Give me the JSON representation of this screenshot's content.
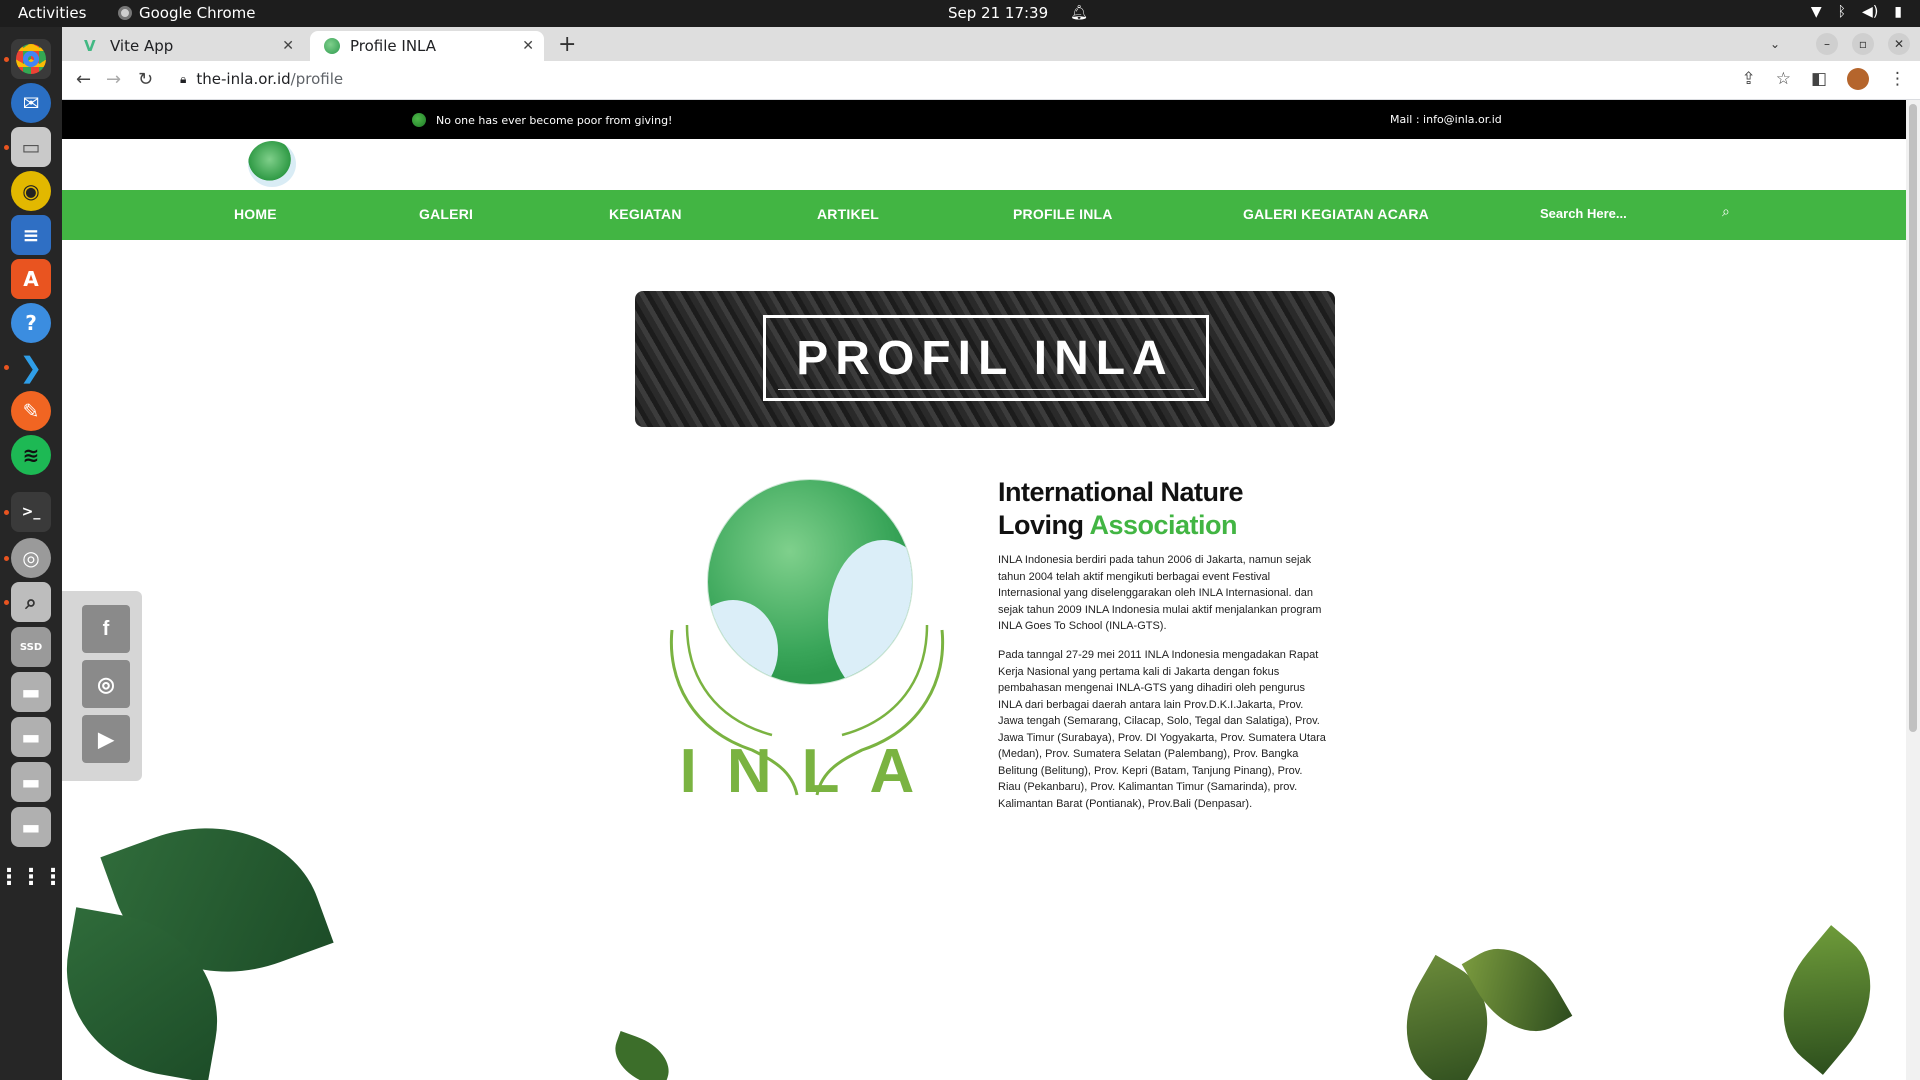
{
  "system": {
    "activities_label": "Activities",
    "app_name": "Google Chrome",
    "clock": "Sep 21  17:39",
    "tray_icons": [
      "wifi-icon",
      "bluetooth-icon",
      "volume-icon",
      "battery-icon"
    ]
  },
  "dock": {
    "apps": [
      "chrome",
      "thunderbird",
      "files",
      "rhythmbox",
      "writer",
      "app-center",
      "help",
      "vscode",
      "postman",
      "spotify",
      "terminal",
      "disk",
      "screenshot",
      "ssd",
      "drive",
      "drive",
      "drive",
      "drive",
      "app-grid"
    ]
  },
  "browser": {
    "tabs": [
      {
        "title": "Vite App",
        "active": false
      },
      {
        "title": "Profile INLA",
        "active": true
      }
    ],
    "url_host": "the-inla.or.id",
    "url_path": "/profile"
  },
  "site": {
    "tagline": "No one has ever become poor from giving!",
    "mail": "Mail : info@inla.or.id",
    "nav": [
      {
        "label": "HOME"
      },
      {
        "label": "GALERI"
      },
      {
        "label": "KEGIATAN"
      },
      {
        "label": "ARTIKEL"
      },
      {
        "label": "PROFILE INLA"
      },
      {
        "label": "GALERI KEGIATAN ACARA"
      }
    ],
    "search_placeholder": "Search Here...",
    "banner_title": "PROFIL INLA",
    "logo_word": "INLA",
    "heading_line1": "International Nature",
    "heading_line2_a": "Loving ",
    "heading_line2_b": "Association",
    "paragraphs": [
      "INLA Indonesia berdiri pada tahun 2006 di Jakarta, namun sejak tahun 2004 telah aktif mengikuti berbagai event Festival Internasional yang diselenggarakan oleh INLA Internasional. dan sejak tahun 2009 INLA Indonesia mulai aktif menjalankan program INLA Goes To School (INLA-GTS).",
      "Pada tanngal 27-29 mei 2011 INLA Indonesia mengadakan Rapat Kerja Nasional yang pertama kali di Jakarta dengan fokus pembahasan mengenai INLA-GTS yang dihadiri oleh pengurus INLA dari berbagai daerah antara lain Prov.D.K.I.Jakarta, Prov. Jawa tengah (Semarang, Cilacap, Solo, Tegal dan Salatiga), Prov. Jawa Timur (Surabaya), Prov. DI Yogyakarta, Prov. Sumatera Utara (Medan), Prov. Sumatera Selatan (Palembang), Prov. Bangka Belitung (Belitung), Prov. Kepri (Batam, Tanjung Pinang), Prov. Riau (Pekanbaru), Prov. Kalimantan Timur (Samarinda), prov. Kalimantan Barat (Pontianak), Prov.Bali (Denpasar)."
    ],
    "social": [
      {
        "icon": "facebook-icon",
        "glyph": "f"
      },
      {
        "icon": "instagram-icon",
        "glyph": "◎"
      },
      {
        "icon": "youtube-icon",
        "glyph": "▶"
      }
    ],
    "colors": {
      "brand_green": "#42b543",
      "logo_word_green": "#7ab341",
      "topbar_black": "#000000"
    }
  }
}
